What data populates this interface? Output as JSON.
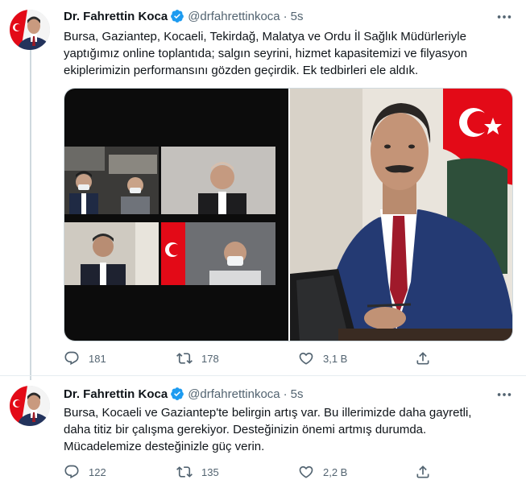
{
  "thread": {
    "tweets": [
      {
        "author_name": "Dr. Fahrettin Koca",
        "author_handle": "@drfahrettinkoca",
        "separator": "·",
        "time": "5s",
        "text_lines": [
          "Bursa, Gaziantep, Kocaeli, Tekirdağ, Malatya ve Ordu İl Sağlık Müdürleriyle",
          "yaptığımız online toplantıda; salgın seyrini, hizmet kapasitemizi ve filyasyon",
          "ekiplerimizin performansını gözden geçirdik. Ek tedbirleri ele aldık."
        ],
        "stats": {
          "replies": "181",
          "retweets": "178",
          "likes": "3,1 B"
        }
      },
      {
        "author_name": "Dr. Fahrettin Koca",
        "author_handle": "@drfahrettinkoca",
        "separator": "·",
        "time": "5s",
        "text_lines": [
          "Bursa, Kocaeli ve Gaziantep'te belirgin artış var. Bu illerimizde daha gayretli,",
          "daha titiz bir çalışma gerekiyor. Desteğinizin önemi artmış durumda.",
          "Mücadelemize desteğinizle güç verin."
        ],
        "stats": {
          "replies": "122",
          "retweets": "135",
          "likes": "2,2 B"
        }
      }
    ]
  },
  "icons": {
    "verified": "verified-badge-icon",
    "more": "more-options-icon",
    "reply": "reply-icon",
    "retweet": "retweet-icon",
    "like": "like-icon",
    "share": "share-icon"
  },
  "colors": {
    "verified": "#1d9bf0",
    "text": "#0f1419",
    "muted": "#536471",
    "thread_line": "#cfd9de",
    "flag_red": "#e30a17"
  }
}
